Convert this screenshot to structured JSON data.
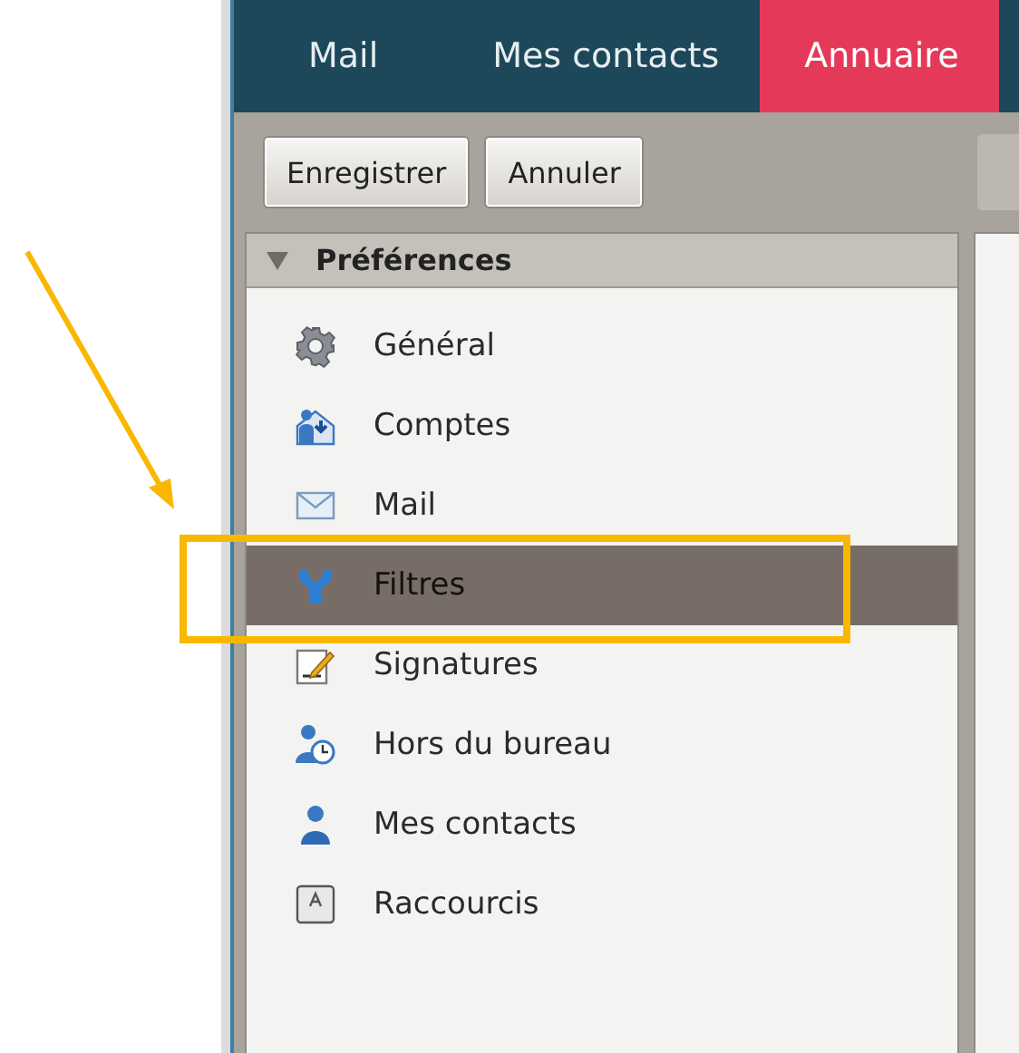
{
  "tabs": [
    {
      "label": "Mail",
      "selected": false
    },
    {
      "label": "Mes contacts",
      "selected": false
    },
    {
      "label": "Annuaire",
      "selected": true
    }
  ],
  "toolbar": {
    "buttons": [
      "Enregistrer",
      "Annuler"
    ]
  },
  "preferences": {
    "title": "Préférences",
    "expanded": true,
    "items": [
      {
        "label": "Général",
        "kind": "gear",
        "selected": false
      },
      {
        "label": "Comptes",
        "kind": "accounts",
        "selected": false
      },
      {
        "label": "Mail",
        "kind": "envelope",
        "selected": false
      },
      {
        "label": "Filtres",
        "kind": "filter",
        "selected": true
      },
      {
        "label": "Signatures",
        "kind": "signature",
        "selected": false
      },
      {
        "label": "Hors du bureau",
        "kind": "away",
        "selected": false
      },
      {
        "label": "Mes contacts",
        "kind": "person",
        "selected": false
      },
      {
        "label": "Raccourcis",
        "kind": "key",
        "selected": false
      }
    ]
  }
}
